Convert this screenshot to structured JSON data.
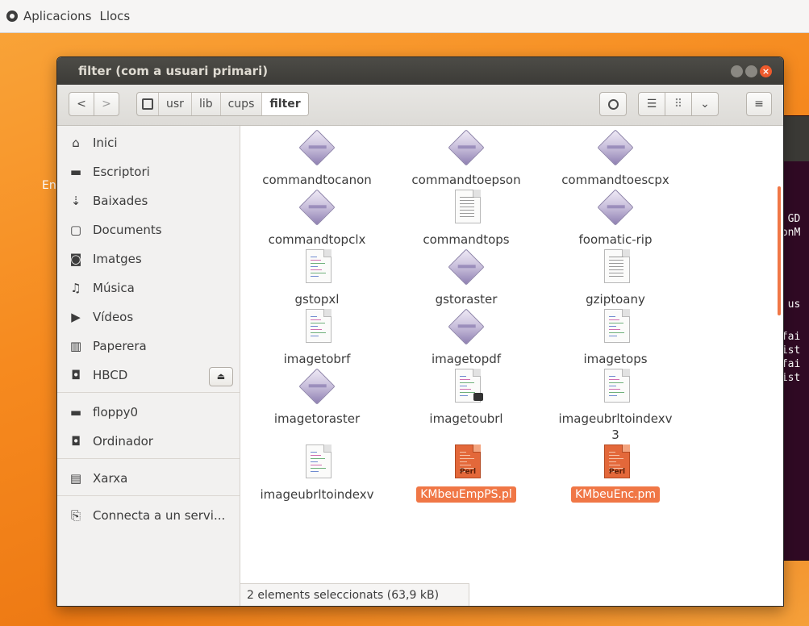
{
  "topbar": {
    "menu": [
      "Aplicacions",
      "Llocs"
    ]
  },
  "desktop_label": "En",
  "terminal_lines": [
    ": GD",
    "LonM",
    "n us",
    " fai",
    "xist",
    " fai",
    "xist"
  ],
  "window": {
    "title": "filter (com a usuari primari)",
    "close_glyph": "×"
  },
  "toolbar": {
    "back": "<",
    "forward": ">",
    "path": [
      "usr",
      "lib",
      "cups",
      "filter"
    ],
    "search_glyph": "🔍",
    "list_glyph": "☰",
    "grid_glyph": "⠿",
    "dropdown_glyph": "⌄",
    "menu_glyph": "≡"
  },
  "sidebar": {
    "items": [
      {
        "label": "Inici",
        "icon": "home-icon",
        "glyph": "⌂"
      },
      {
        "label": "Escriptori",
        "icon": "desktop-folder-icon",
        "glyph": "▬"
      },
      {
        "label": "Baixades",
        "icon": "download-icon",
        "glyph": "⇣"
      },
      {
        "label": "Documents",
        "icon": "document-icon",
        "glyph": "▢"
      },
      {
        "label": "Imatges",
        "icon": "camera-icon",
        "glyph": "◙"
      },
      {
        "label": "Música",
        "icon": "music-icon",
        "glyph": "♫"
      },
      {
        "label": "Vídeos",
        "icon": "video-icon",
        "glyph": "▶"
      },
      {
        "label": "Paperera",
        "icon": "trash-icon",
        "glyph": "▥"
      },
      {
        "label": "HBCD",
        "icon": "drive-icon",
        "glyph": "◘"
      },
      {
        "label": "floppy0",
        "icon": "floppy-icon",
        "glyph": "▬"
      },
      {
        "label": "Ordinador",
        "icon": "computer-icon",
        "glyph": "◘"
      },
      {
        "label": "Xarxa",
        "icon": "network-icon",
        "glyph": "▤"
      },
      {
        "label": "Connecta a un servi...",
        "icon": "server-icon",
        "glyph": "⎘"
      }
    ],
    "eject_glyph": "⏏"
  },
  "files": [
    {
      "name": "commandtocanon",
      "type": "binary"
    },
    {
      "name": "commandtoepson",
      "type": "binary"
    },
    {
      "name": "commandtoescpx",
      "type": "binary"
    },
    {
      "name": "commandtopclx",
      "type": "binary"
    },
    {
      "name": "commandtops",
      "type": "text"
    },
    {
      "name": "foomatic-rip",
      "type": "binary"
    },
    {
      "name": "gstopxl",
      "type": "code"
    },
    {
      "name": "gstoraster",
      "type": "binary"
    },
    {
      "name": "gziptoany",
      "type": "text"
    },
    {
      "name": "imagetobrf",
      "type": "code"
    },
    {
      "name": "imagetopdf",
      "type": "binary"
    },
    {
      "name": "imagetops",
      "type": "code"
    },
    {
      "name": "imagetoraster",
      "type": "binary"
    },
    {
      "name": "imagetoubrl",
      "type": "code-link"
    },
    {
      "name": "imageubrltoindexv",
      "name2": "3",
      "type": "code"
    },
    {
      "name": "imageubrltoindexv",
      "type": "code"
    },
    {
      "name": "KMbeuEmpPS.pl",
      "type": "perl",
      "selected": true,
      "tag": "Perl"
    },
    {
      "name": "KMbeuEnc.pm",
      "type": "perl",
      "selected": true,
      "tag": "Perl"
    }
  ],
  "status": "2 elements seleccionats (63,9 kB)"
}
